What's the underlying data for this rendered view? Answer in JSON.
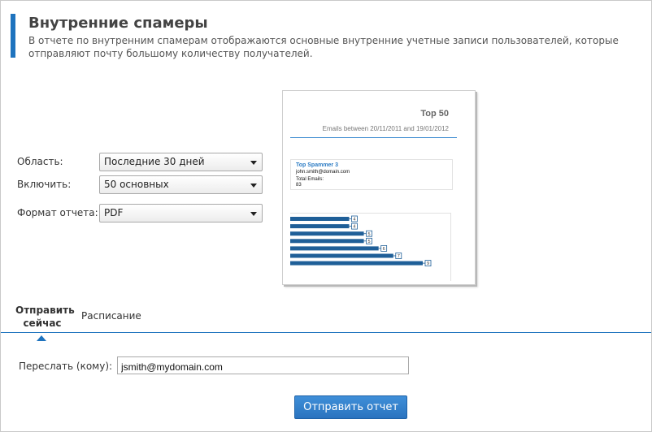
{
  "header": {
    "title": "Внутренние спамеры",
    "description": "В отчете по внутренним спамерам отображаются основные внутренние учетные записи пользователей, которые отправляют почту большому количеству получателей."
  },
  "form": {
    "scope_label": "Область:",
    "scope_value": "Последние 30 дней",
    "include_label": "Включить:",
    "include_value": "50 основных",
    "format_label": "Формат отчета:",
    "format_value": "PDF"
  },
  "preview": {
    "title": "Top 50",
    "subtitle": "Emails between 20/11/2011 and 19/01/2012",
    "card_title": "Top Spammer 3",
    "card_email": "john.smith@domain.com",
    "card_total_label": "Total Emails:",
    "card_total_value": "83",
    "bar_values": [
      "4",
      "4",
      "5",
      "5",
      "6",
      "7",
      "9"
    ]
  },
  "tabs": {
    "send_now": "Отправить сейчас",
    "schedule": "Расписание"
  },
  "forward": {
    "label": "Переслать (кому):",
    "value": "jsmith@mydomain.com"
  },
  "send_button": "Отправить отчет",
  "colors": {
    "accent": "#1e73be",
    "bar": "#1f5f98"
  }
}
